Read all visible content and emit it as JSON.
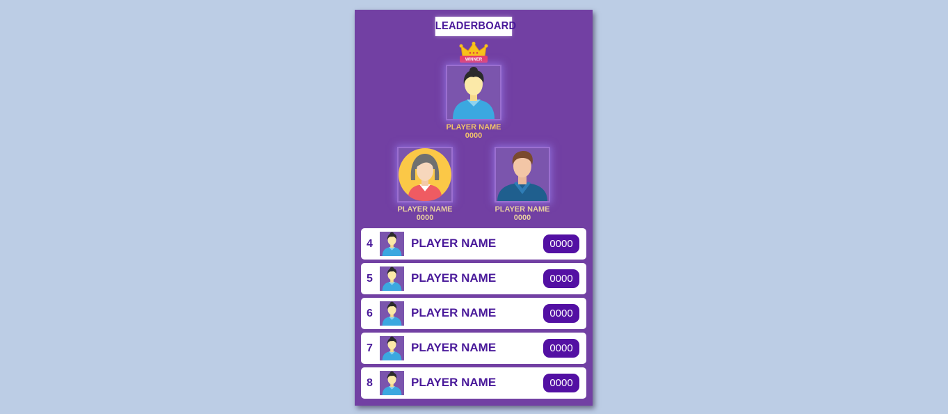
{
  "title": "LEADERBOARD",
  "colors": {
    "page_background": "#bccde5",
    "board_background": "#7240a3",
    "accent": "#4a1a9a",
    "score_pill": "#5310a3",
    "winner_text": "#f0c36b"
  },
  "winner": {
    "badge": "WINNER",
    "name": "PLAYER NAME",
    "score": "0000",
    "icon": "female-avatar-icon"
  },
  "second": {
    "name": "PLAYER NAME",
    "score": "0000",
    "icon": "woman-avatar-icon"
  },
  "third": {
    "name": "PLAYER NAME",
    "score": "0000",
    "icon": "man-avatar-icon"
  },
  "rows": [
    {
      "rank": "4",
      "name": "PLAYER NAME",
      "score": "0000"
    },
    {
      "rank": "5",
      "name": "PLAYER NAME",
      "score": "0000"
    },
    {
      "rank": "6",
      "name": "PLAYER NAME",
      "score": "0000"
    },
    {
      "rank": "7",
      "name": "PLAYER NAME",
      "score": "0000"
    },
    {
      "rank": "8",
      "name": "PLAYER NAME",
      "score": "0000"
    }
  ]
}
